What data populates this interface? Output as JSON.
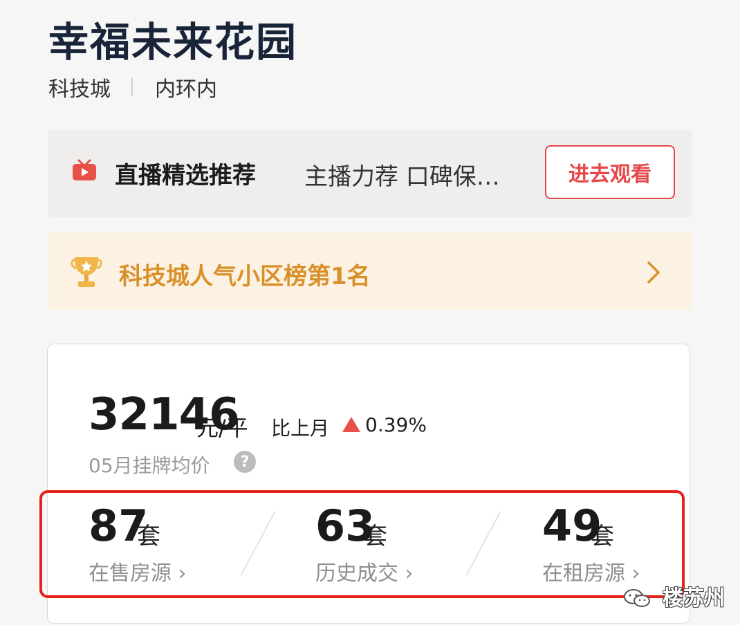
{
  "community": {
    "name": "幸福未来花园",
    "tags": [
      "科技城",
      "内环内"
    ]
  },
  "live_banner": {
    "title": "直播精选推荐",
    "description": "主播力荐 口碑保…",
    "button_label": "进去观看",
    "icon": "tv-icon"
  },
  "rank_banner": {
    "text": "科技城人气小区榜第1名",
    "icon": "trophy-icon"
  },
  "price": {
    "value": "32146",
    "unit": "元/平",
    "mom_label": "比上月",
    "mom_direction": "up",
    "mom_value": "0.39%",
    "subtitle": "05月挂牌均价",
    "help_glyph": "?"
  },
  "stats": [
    {
      "count": "87",
      "unit": "套",
      "label": "在售房源 ›"
    },
    {
      "count": "63",
      "unit": "套",
      "label": "历史成交 ›"
    },
    {
      "count": "49",
      "unit": "套",
      "label": "在租房源 ›"
    }
  ],
  "watermark": {
    "text": "楼苏州",
    "icon": "wechat-icon"
  },
  "colors": {
    "title": "#1a2438",
    "accent_red": "#e5474a",
    "rank_gold": "#d9902a",
    "rank_bg": "#fcf2e3",
    "highlight_border": "#e6231b"
  }
}
